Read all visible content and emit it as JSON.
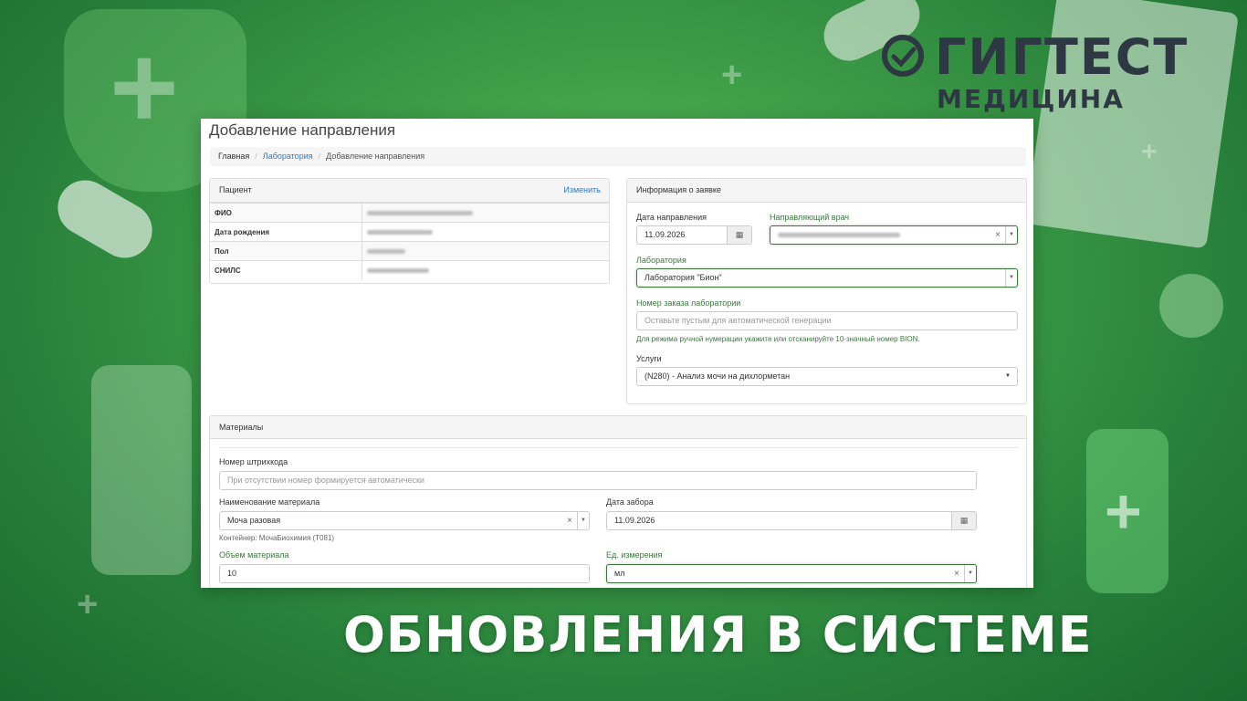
{
  "brand": {
    "name": "ГИГТЕСТ",
    "sub": "МЕДИЦИНА"
  },
  "banner": {
    "title": "ОБНОВЛЕНИЯ  В СИСТЕМЕ"
  },
  "page": {
    "title": "Добавление направления"
  },
  "breadcrumb": {
    "home": "Главная",
    "section": "Лаборатория",
    "current": "Добавление направления",
    "separator": "/"
  },
  "patient": {
    "heading": "Пациент",
    "edit_label": "Изменить",
    "rows": [
      {
        "label": "ФИО"
      },
      {
        "label": "Дата рождения"
      },
      {
        "label": "Пол"
      },
      {
        "label": "СНИЛС"
      }
    ]
  },
  "request": {
    "heading": "Информация о заявке",
    "date_label": "Дата направления",
    "date_value": "11.09.2026",
    "doctor_label": "Направляющий врач",
    "lab_label": "Лаборатория",
    "lab_value": "Лаборатория \"Бион\"",
    "order_label": "Номер заказа лаборатории",
    "order_placeholder": "Оставьте пустым для автоматической генерации",
    "order_help": "Для режима ручной нумерации укажите или отсканируйте 10-значный номер BION.",
    "services_label": "Услуги",
    "services_value": "(N280) - Анализ мочи на дихлорметан"
  },
  "materials": {
    "heading": "Материалы",
    "barcode_label": "Номер штрихкода",
    "barcode_placeholder": "При отсутствии номер формируется автоматически",
    "material_label": "Наименование материала",
    "material_value": "Моча разовая",
    "container_help": "Контейнер: МочаБиохимия (Т081)",
    "collect_date_label": "Дата забора",
    "collect_date_value": "11.09.2026",
    "volume_label": "Объем материала",
    "volume_value": "10",
    "unit_label": "Ед. измерения",
    "unit_value": "мл"
  },
  "colors": {
    "accent_green": "#3c763d",
    "link": "#337ab7",
    "brand_dark": "#2e3842"
  },
  "icons": {
    "calendar": "calendar-icon",
    "clear": "clear-icon",
    "dropdown": "caret-down-icon"
  }
}
